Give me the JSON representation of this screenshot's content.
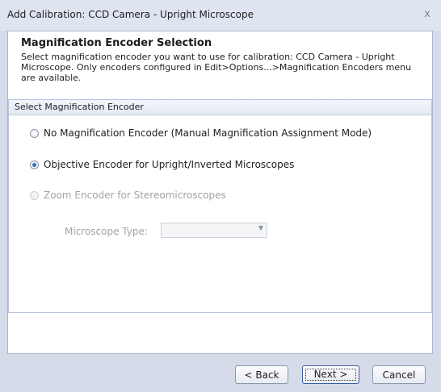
{
  "window": {
    "title": "Add Calibration: CCD Camera - Upright Microscope",
    "close_glyph": "x"
  },
  "header": {
    "heading": "Magnification Encoder Selection",
    "description": "Select magnification encoder you want to use for calibration: CCD Camera - Upright Microscope. Only encoders configured in Edit>Options...>Magnification Encoders menu are available."
  },
  "group": {
    "title": "Select Magnification Encoder",
    "options": [
      {
        "label": "No Magnification Encoder (Manual Magnification Assignment Mode)",
        "checked": false,
        "enabled": true
      },
      {
        "label": "Objective Encoder for Upright/Inverted Microscopes",
        "checked": true,
        "enabled": true
      },
      {
        "label": "Zoom Encoder for Stereomicroscopes",
        "checked": false,
        "enabled": false
      }
    ],
    "microscope_type_label": "Microscope Type:",
    "microscope_type_value": "",
    "combo_arrow_glyph": "▼"
  },
  "footer": {
    "back_label": "< Back",
    "next_label": "Next >",
    "cancel_label": "Cancel"
  },
  "colors": {
    "radio_checked": "#3b6bc8",
    "disabled_text": "#a3a3a3",
    "window_bg": "#d6dbe9"
  }
}
